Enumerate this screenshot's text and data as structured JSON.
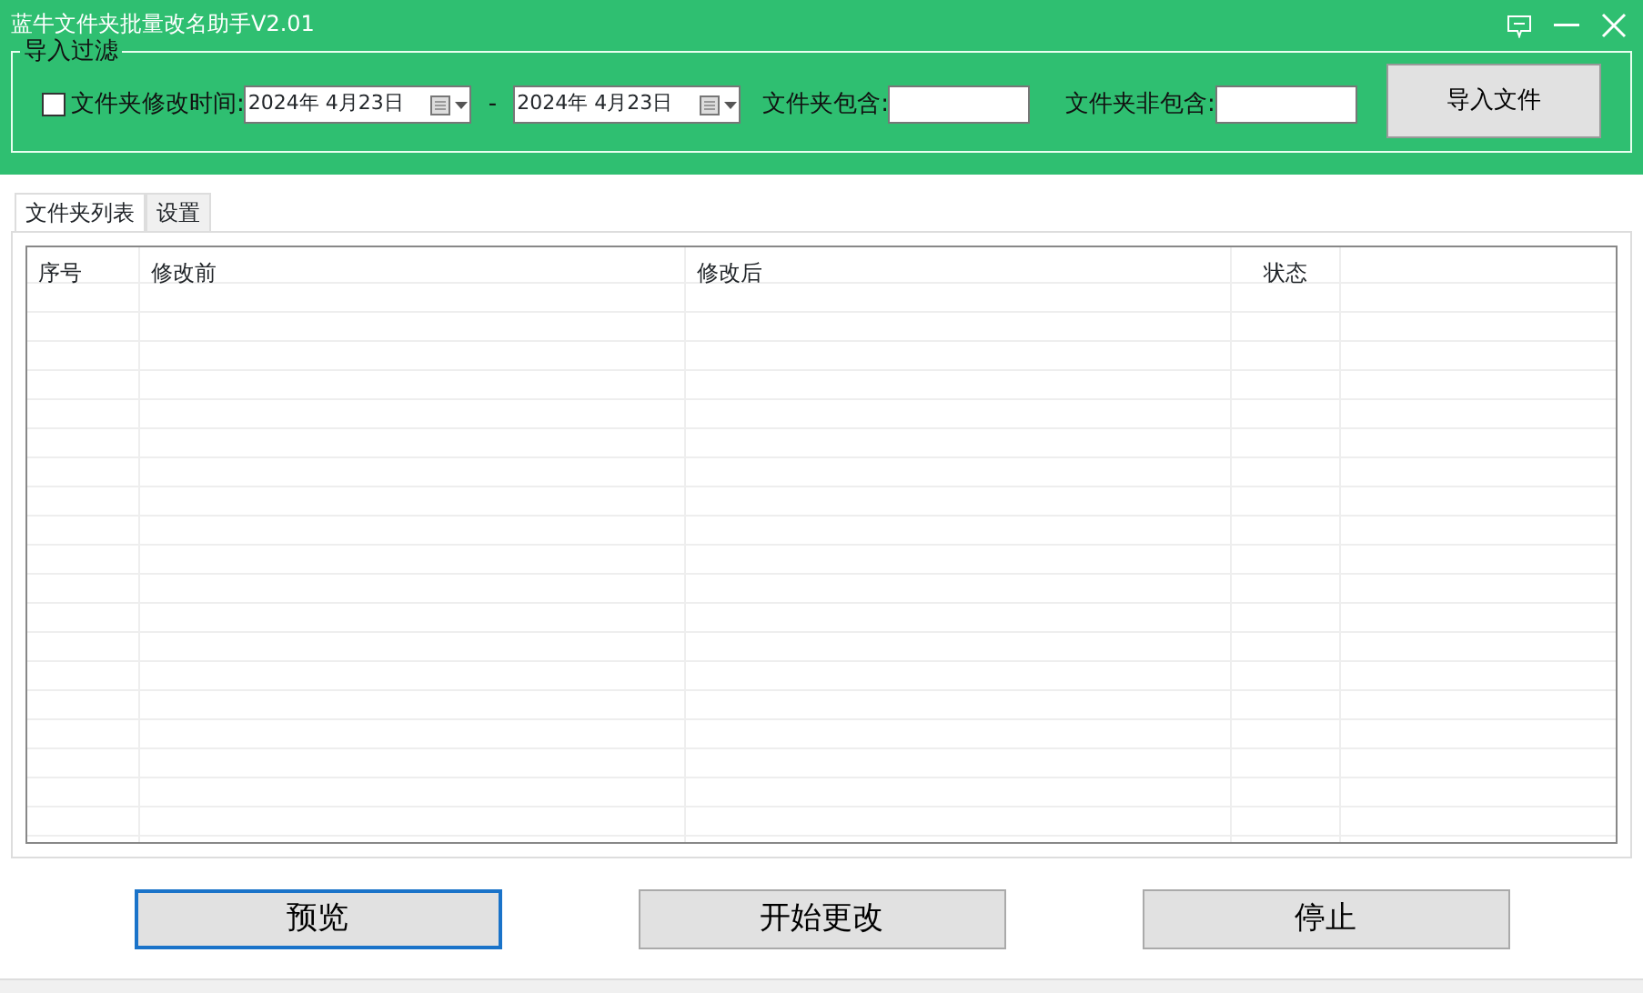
{
  "window": {
    "title": "蓝牛文件夹批量改名助手V2.01"
  },
  "filter": {
    "legend": "导入过滤",
    "date_filter": {
      "label": "文件夹修改时间:",
      "checked": false
    },
    "date_from": "2024年  4月23日",
    "separator": "-",
    "date_to": "2024年  4月23日",
    "include": {
      "label": "文件夹包含:"
    },
    "exclude": {
      "label": "文件夹非包含:"
    },
    "import_button": "导入文件"
  },
  "tabs": [
    {
      "label": "文件夹列表",
      "selected": true
    },
    {
      "label": "设置",
      "selected": false
    }
  ],
  "table": {
    "columns": [
      "序号",
      "修改前",
      "修改后",
      "状态"
    ]
  },
  "buttons": [
    {
      "label": "预览",
      "focused": true
    },
    {
      "label": "开始更改",
      "focused": false
    },
    {
      "label": "停止",
      "focused": false
    }
  ]
}
